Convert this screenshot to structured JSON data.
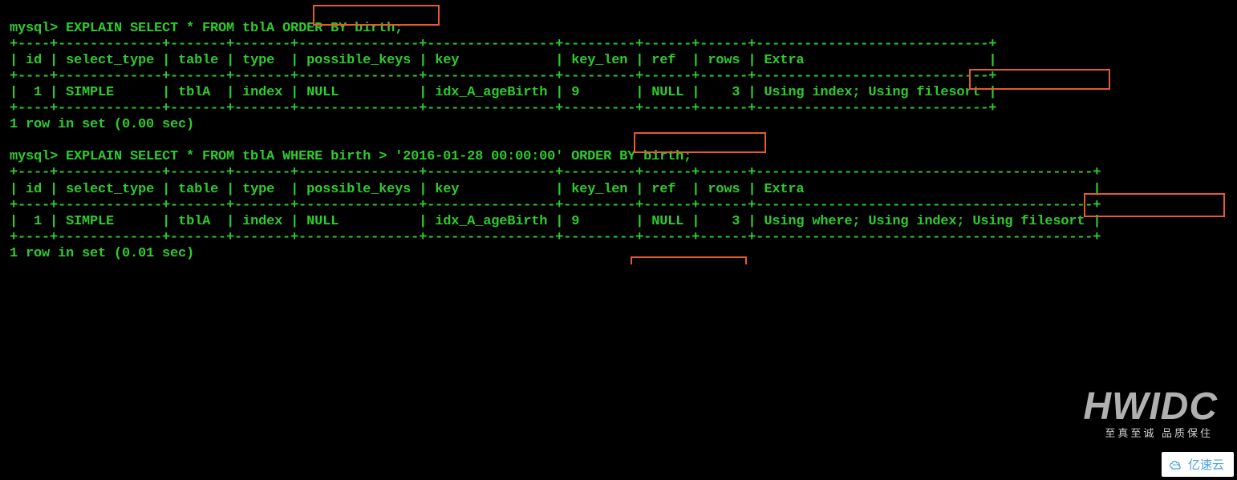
{
  "queries": [
    {
      "prompt": "mysql> ",
      "sql": "EXPLAIN SELECT * FROM tblA ORDER BY birth;",
      "headers": [
        "id",
        "select_type",
        "table",
        "type",
        "possible_keys",
        "key",
        "key_len",
        "ref",
        "rows",
        "Extra"
      ],
      "row": {
        "id": "1",
        "select_type": "SIMPLE",
        "table": "tblA",
        "type": "index",
        "possible_keys": "NULL",
        "key": "idx_A_ageBirth",
        "key_len": "9",
        "ref": "NULL",
        "rows": "3",
        "Extra": "Using index; Using filesort"
      },
      "footer": "1 row in set (0.00 sec)"
    },
    {
      "prompt": "mysql> ",
      "sql": "EXPLAIN SELECT * FROM tblA WHERE birth > '2016-01-28 00:00:00' ORDER BY birth;",
      "headers": [
        "id",
        "select_type",
        "table",
        "type",
        "possible_keys",
        "key",
        "key_len",
        "ref",
        "rows",
        "Extra"
      ],
      "row": {
        "id": "1",
        "select_type": "SIMPLE",
        "table": "tblA",
        "type": "index",
        "possible_keys": "NULL",
        "key": "idx_A_ageBirth",
        "key_len": "9",
        "ref": "NULL",
        "rows": "3",
        "Extra": "Using where; Using index; Using filesort"
      },
      "footer": "1 row in set (0.01 sec)"
    }
  ],
  "watermark": {
    "big": "HWIDC",
    "small": "至真至诚 品质保住",
    "badge": "亿速云"
  },
  "annotations": {
    "box1": "ORDER BY birth",
    "box2": "Using filesort",
    "box3": "ORDER BY birth",
    "box4": "Using filesort"
  }
}
